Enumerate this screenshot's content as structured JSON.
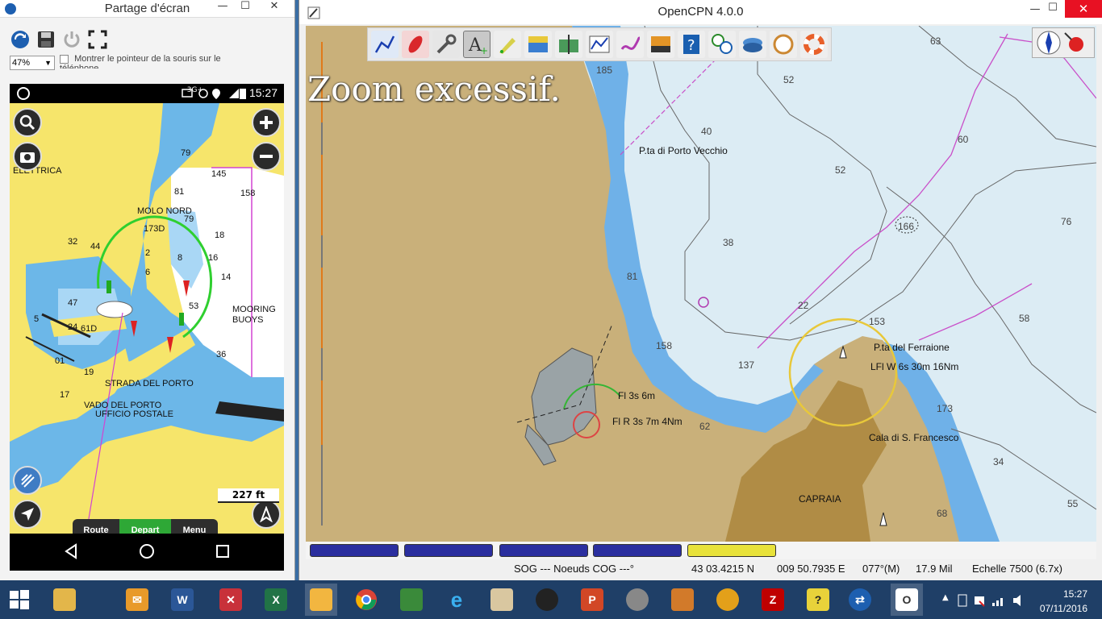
{
  "share_window": {
    "title": "Partage d'écran",
    "zoom_value": "47%",
    "pointer_option": "Montrer le pointeur de la souris sur le téléphone",
    "tools": [
      "refresh-icon",
      "save-icon",
      "power-icon",
      "fullscreen-icon"
    ]
  },
  "phone": {
    "status": {
      "time": "15:27",
      "network": "3G+"
    },
    "map_labels": {
      "elettrica": "ELETTRICA",
      "molo_nord": "MOLO NORD",
      "mooring_1": "MOORING",
      "mooring_2": "BUOYS",
      "strada": "STRADA DEL PORTO",
      "vado": "VADO DEL PORTO",
      "ufficio": "UFFICIO POSTALE",
      "d173": "173D",
      "d61": "61D"
    },
    "depths": [
      "79",
      "145",
      "158",
      "81",
      "79",
      "18",
      "16",
      "14",
      "8",
      "6",
      "2",
      "53",
      "32",
      "44",
      "47",
      "24",
      "5",
      "19",
      "17",
      "01",
      "36"
    ],
    "scale": "227  ft",
    "bottom_buttons": {
      "route": "Route",
      "depart": "Depart",
      "menu": "Menu"
    }
  },
  "opencpn": {
    "title": "OpenCPN 4.0.0",
    "zoom_message": "Zoom excessif.",
    "chart_labels": {
      "porto_vecchio": "P.ta di Porto Vecchio",
      "ferraione": "P.ta del Ferraione",
      "light_ferraione": "LFl W 6s 30m 16Nm",
      "fl3s": "Fl 3s 6m",
      "flr3s": "Fl R 3s 7m 4Nm",
      "cala": "Cala di S. Francesco",
      "capraia": "CAPRAIA"
    },
    "depths": {
      "d63": "63",
      "d52a": "52",
      "d40": "40",
      "d60": "60",
      "d52b": "52",
      "d76": "76",
      "d166": "166",
      "d38": "38",
      "d81": "81",
      "d22": "22",
      "d153": "153",
      "d58": "58",
      "d158": "158",
      "d137": "137",
      "d173": "173",
      "d62": "62",
      "d34": "34",
      "d68": "68",
      "d55": "55",
      "d185": "185"
    },
    "status": {
      "sog": "SOG --- Noeuds COG ---°",
      "lat": "43 03.4215 N",
      "lon": "009 50.7935 E",
      "bearing": "077°(M)",
      "dist": "17.9 Mil",
      "scale": "Echelle 7500 (6.7x)"
    },
    "chartbar": {
      "button_colors": [
        "#2b2f9f",
        "#2b2f9f",
        "#2b2f9f",
        "#2b2f9f",
        "#e8e23a"
      ]
    }
  },
  "taskbar": {
    "clock_time": "15:27",
    "clock_date": "07/11/2016",
    "apps": [
      "start",
      "file-explorer",
      "outlook",
      "word",
      "pdf-tool",
      "excel",
      "sticky",
      "chrome",
      "sheets-tool",
      "internet-explorer",
      "books",
      "compass-app",
      "powerpoint",
      "globe-pro",
      "van-app",
      "crowd-app",
      "filezilla",
      "help",
      "teamviewer",
      "opencpn"
    ]
  }
}
